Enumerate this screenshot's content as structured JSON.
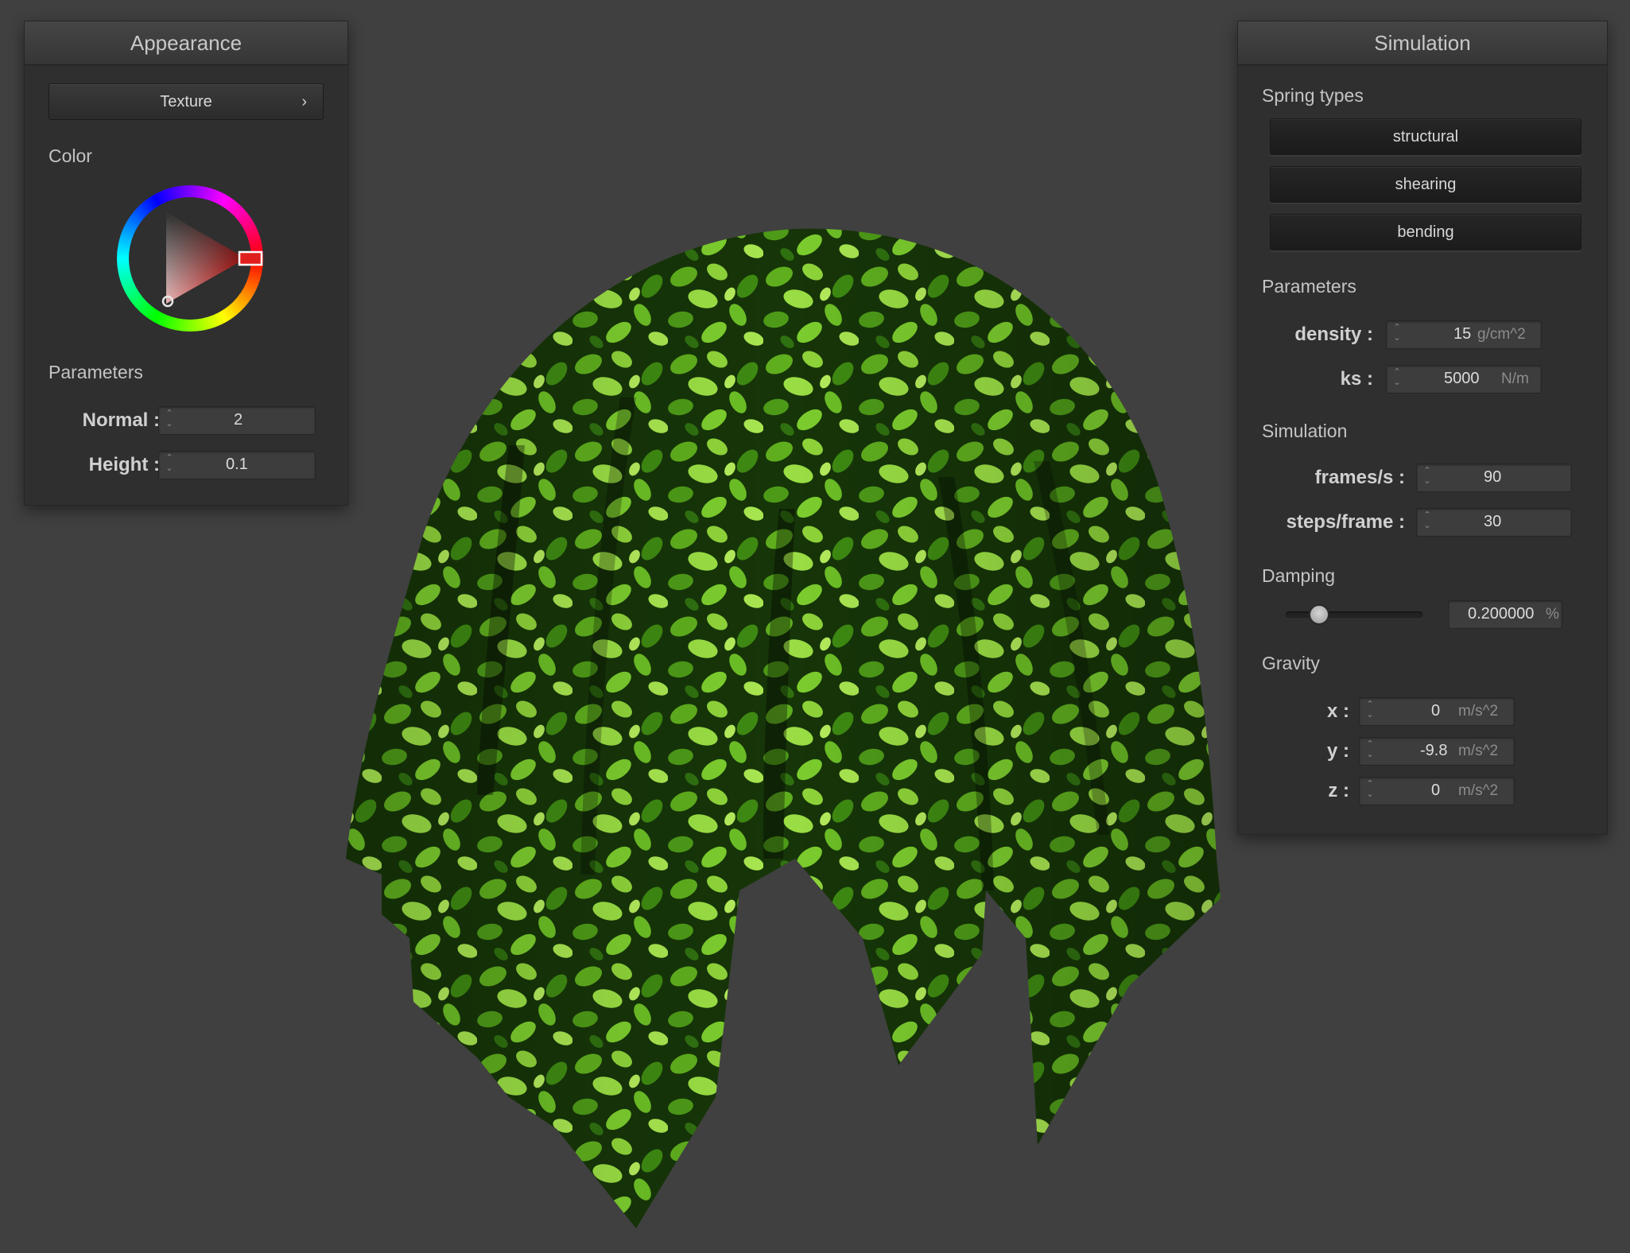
{
  "appearance": {
    "title": "Appearance",
    "texture_button": "Texture",
    "texture_chevron": "›",
    "color_label": "Color",
    "params_label": "Parameters",
    "normal": {
      "label": "Normal :",
      "value": "2"
    },
    "height": {
      "label": "Height :",
      "value": "0.1"
    }
  },
  "simulation": {
    "title": "Simulation",
    "spring_types_label": "Spring types",
    "spring_buttons": [
      "structural",
      "shearing",
      "bending"
    ],
    "params_label": "Parameters",
    "density": {
      "label": "density :",
      "value": "15",
      "unit": "g/cm^2"
    },
    "ks": {
      "label": "ks :",
      "value": "5000",
      "unit": "N/m"
    },
    "sim_label": "Simulation",
    "fps": {
      "label": "frames/s :",
      "value": "90"
    },
    "steps": {
      "label": "steps/frame :",
      "value": "30"
    },
    "damping_label": "Damping",
    "damping": {
      "value": "0.200000",
      "unit": "%",
      "slider_fraction": 0.2
    },
    "gravity_label": "Gravity",
    "gx": {
      "label": "x :",
      "value": "0",
      "unit": "m/s^2"
    },
    "gy": {
      "label": "y :",
      "value": "-9.8",
      "unit": "m/s^2"
    },
    "gz": {
      "label": "z :",
      "value": "0",
      "unit": "m/s^2"
    }
  },
  "colors": {
    "background": "#404040",
    "panel": "#2f2f2f",
    "cloth_dark": "#143006",
    "cloth_mid": "#3f8a12",
    "cloth_light": "#8ed63a",
    "selected_color": "#e0201e"
  },
  "icons": {
    "spinner": "up-down-arrows-icon",
    "chevron": "chevron-right-icon",
    "color_wheel": "color-wheel-icon"
  }
}
